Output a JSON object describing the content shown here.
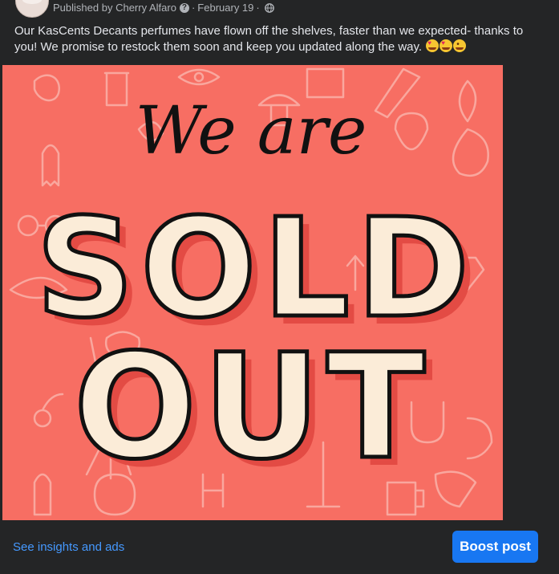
{
  "post": {
    "author_prefix": "Published by",
    "author": "Cherry Alfaro",
    "date": "February 19",
    "separator": "·",
    "caption": "Our KasCents Decants perfumes have flown off the shelves, faster than we expected- thanks to you! We promise to restock them soon and keep you updated along the way.",
    "emojis": [
      "heart-eyes-emoji",
      "heart-eyes-emoji",
      "kissing-emoji"
    ]
  },
  "image": {
    "script_line": "We are",
    "line1": "SOLD",
    "line2": "OUT",
    "background": "#f76e63",
    "letter_fill": "#fbecd8",
    "letter_shadow": "#e34b44"
  },
  "footer": {
    "insights_label": "See insights and ads",
    "boost_label": "Boost post"
  },
  "colors": {
    "card_bg": "#242526",
    "link": "#4599ff",
    "button": "#1877f2"
  }
}
